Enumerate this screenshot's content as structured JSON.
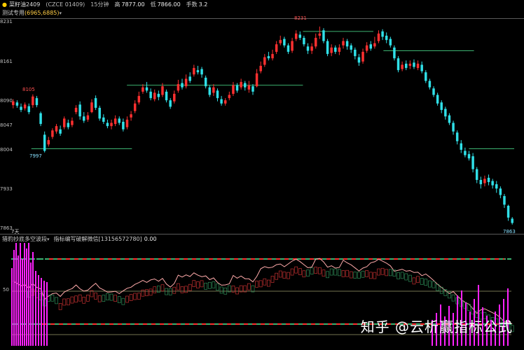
{
  "header": {
    "symbol": "菜籽油2409",
    "code": "(CZCE 01409)",
    "period": "15分钟",
    "high_label": "高",
    "high_value": "7877.00",
    "low_label": "低",
    "low_value": "7866.00",
    "lots_label": "手数",
    "lots_value": "3.2"
  },
  "main_indicator": {
    "name": "测试专用",
    "params": "(6965,6885)"
  },
  "sub_indicator": {
    "name": "猎豹抄底多空波段",
    "name2": "指标编写破解微信",
    "contact": "[13156572780]",
    "value": "0.00"
  },
  "price_labels": [
    "8231",
    "8161",
    "8090",
    "8047",
    "8004",
    "7933",
    "7863"
  ],
  "sub_labels": [
    "50"
  ],
  "annotations": {
    "hi_left": "8105",
    "low_left": "7997",
    "peak": "8231",
    "last": "7863",
    "corner": "7天"
  },
  "watermark": "知乎 @云析赢指标公式",
  "colors": {
    "up": "#ff3030",
    "down": "#30e0e8",
    "green_line": "#3cb371",
    "magenta": "#ff22ff",
    "pink": "#ffaaaa"
  },
  "chart_data": {
    "type": "candlestick",
    "ylim": [
      7855,
      8240
    ],
    "candles": [
      [
        8085,
        8092,
        8096,
        8079
      ],
      [
        8090,
        8084,
        8094,
        8080
      ],
      [
        8082,
        8076,
        8088,
        8072
      ],
      [
        8079,
        8086,
        8090,
        8075
      ],
      [
        8083,
        8072,
        8088,
        8068
      ],
      [
        8085,
        8101,
        8105,
        8080
      ],
      [
        8098,
        8085,
        8102,
        8081
      ],
      [
        8070,
        8050,
        8073,
        8046
      ],
      [
        8030,
        8000,
        8036,
        7997
      ],
      [
        8012,
        8020,
        8026,
        8008
      ],
      [
        8026,
        8038,
        8042,
        8022
      ],
      [
        8036,
        8046,
        8050,
        8032
      ],
      [
        8040,
        8032,
        8047,
        8028
      ],
      [
        8044,
        8060,
        8064,
        8040
      ],
      [
        8052,
        8044,
        8058,
        8040
      ],
      [
        8048,
        8056,
        8062,
        8044
      ],
      [
        8072,
        8080,
        8085,
        8068
      ],
      [
        8086,
        8064,
        8092,
        8058
      ],
      [
        8064,
        8056,
        8072,
        8052
      ],
      [
        8058,
        8066,
        8072,
        8054
      ],
      [
        8072,
        8090,
        8096,
        8070
      ],
      [
        8098,
        8080,
        8103,
        8076
      ],
      [
        8080,
        8060,
        8084,
        8056
      ],
      [
        8062,
        8054,
        8068,
        8050
      ],
      [
        8052,
        8046,
        8058,
        8042
      ],
      [
        8046,
        8052,
        8058,
        8040
      ],
      [
        8050,
        8060,
        8066,
        8046
      ],
      [
        8060,
        8052,
        8064,
        8048
      ],
      [
        8054,
        8040,
        8060,
        8036
      ],
      [
        8044,
        8058,
        8064,
        8040
      ],
      [
        8062,
        8068,
        8074,
        8056
      ],
      [
        8074,
        8088,
        8094,
        8070
      ],
      [
        8090,
        8102,
        8110,
        8086
      ],
      [
        8110,
        8118,
        8124,
        8106
      ],
      [
        8118,
        8112,
        8128,
        8108
      ],
      [
        8110,
        8098,
        8116,
        8094
      ],
      [
        8096,
        8108,
        8114,
        8092
      ],
      [
        8106,
        8100,
        8112,
        8094
      ],
      [
        8104,
        8120,
        8126,
        8100
      ],
      [
        8110,
        8094,
        8114,
        8090
      ],
      [
        8094,
        8082,
        8098,
        8078
      ],
      [
        8092,
        8106,
        8112,
        8088
      ],
      [
        8112,
        8124,
        8132,
        8108
      ],
      [
        8126,
        8118,
        8134,
        8114
      ],
      [
        8120,
        8134,
        8142,
        8116
      ],
      [
        8138,
        8130,
        8146,
        8126
      ],
      [
        8142,
        8154,
        8160,
        8138
      ],
      [
        8150,
        8146,
        8158,
        8142
      ],
      [
        8152,
        8142,
        8156,
        8136
      ],
      [
        8136,
        8120,
        8140,
        8116
      ],
      [
        8118,
        8104,
        8122,
        8100
      ],
      [
        8108,
        8118,
        8124,
        8102
      ],
      [
        8112,
        8098,
        8116,
        8092
      ],
      [
        8096,
        8088,
        8102,
        8084
      ],
      [
        8088,
        8094,
        8098,
        8084
      ],
      [
        8098,
        8104,
        8110,
        8094
      ],
      [
        8106,
        8122,
        8128,
        8102
      ],
      [
        8122,
        8112,
        8126,
        8108
      ],
      [
        8118,
        8128,
        8134,
        8114
      ],
      [
        8126,
        8118,
        8130,
        8112
      ],
      [
        8114,
        8122,
        8130,
        8108
      ],
      [
        8120,
        8110,
        8124,
        8104
      ],
      [
        8120,
        8144,
        8152,
        8118
      ],
      [
        8148,
        8158,
        8166,
        8144
      ],
      [
        8160,
        8174,
        8180,
        8156
      ],
      [
        8176,
        8172,
        8184,
        8168
      ],
      [
        8172,
        8180,
        8188,
        8168
      ],
      [
        8184,
        8198,
        8204,
        8180
      ],
      [
        8200,
        8206,
        8214,
        8196
      ],
      [
        8208,
        8196,
        8212,
        8192
      ],
      [
        8196,
        8184,
        8200,
        8180
      ],
      [
        8186,
        8204,
        8210,
        8182
      ],
      [
        8208,
        8218,
        8224,
        8204
      ],
      [
        8216,
        8210,
        8222,
        8206
      ],
      [
        8210,
        8198,
        8214,
        8194
      ],
      [
        8194,
        8186,
        8200,
        8180
      ],
      [
        8186,
        8194,
        8200,
        8180
      ],
      [
        8194,
        8210,
        8218,
        8190
      ],
      [
        8214,
        8218,
        8231,
        8208
      ],
      [
        8224,
        8204,
        8228,
        8200
      ],
      [
        8204,
        8180,
        8208,
        8176
      ],
      [
        8182,
        8192,
        8198,
        8176
      ],
      [
        8192,
        8184,
        8196,
        8180
      ],
      [
        8184,
        8192,
        8198,
        8178
      ],
      [
        8196,
        8204,
        8210,
        8190
      ],
      [
        8204,
        8194,
        8208,
        8188
      ],
      [
        8196,
        8188,
        8200,
        8182
      ],
      [
        8188,
        8176,
        8192,
        8170
      ],
      [
        8174,
        8164,
        8180,
        8158
      ],
      [
        8166,
        8184,
        8190,
        8162
      ],
      [
        8186,
        8196,
        8202,
        8182
      ],
      [
        8198,
        8190,
        8204,
        8186
      ],
      [
        8194,
        8200,
        8212,
        8190
      ],
      [
        8204,
        8218,
        8224,
        8200
      ],
      [
        8222,
        8212,
        8226,
        8206
      ],
      [
        8214,
        8206,
        8220,
        8200
      ],
      [
        8208,
        8196,
        8212,
        8192
      ],
      [
        8192,
        8172,
        8196,
        8168
      ],
      [
        8172,
        8150,
        8176,
        8146
      ],
      [
        8152,
        8160,
        8166,
        8148
      ],
      [
        8162,
        8154,
        8168,
        8150
      ],
      [
        8158,
        8162,
        8168,
        8152
      ],
      [
        8164,
        8156,
        8170,
        8152
      ],
      [
        8154,
        8162,
        8168,
        8150
      ],
      [
        8160,
        8148,
        8166,
        8144
      ],
      [
        8146,
        8130,
        8150,
        8126
      ],
      [
        8130,
        8118,
        8134,
        8114
      ],
      [
        8116,
        8104,
        8120,
        8100
      ],
      [
        8104,
        8088,
        8108,
        8084
      ],
      [
        8090,
        8076,
        8094,
        8070
      ],
      [
        8078,
        8064,
        8082,
        8058
      ],
      [
        8066,
        8052,
        8070,
        8048
      ],
      [
        8052,
        8036,
        8056,
        8030
      ],
      [
        8034,
        8018,
        8038,
        8012
      ],
      [
        8014,
        8002,
        8020,
        7996
      ],
      [
        8000,
        7992,
        8006,
        7988
      ],
      [
        7994,
        7986,
        8000,
        7982
      ],
      [
        7990,
        7966,
        7996,
        7960
      ],
      [
        7966,
        7946,
        7970,
        7940
      ],
      [
        7946,
        7938,
        7952,
        7930
      ],
      [
        7940,
        7948,
        7954,
        7934
      ],
      [
        7950,
        7942,
        7956,
        7936
      ],
      [
        7944,
        7936,
        7948,
        7930
      ],
      [
        7938,
        7930,
        7944,
        7922
      ],
      [
        7930,
        7918,
        7934,
        7912
      ],
      [
        7916,
        7900,
        7920,
        7894
      ],
      [
        7898,
        7876,
        7900,
        7870
      ],
      [
        7874,
        7866,
        7877,
        7863
      ]
    ]
  }
}
